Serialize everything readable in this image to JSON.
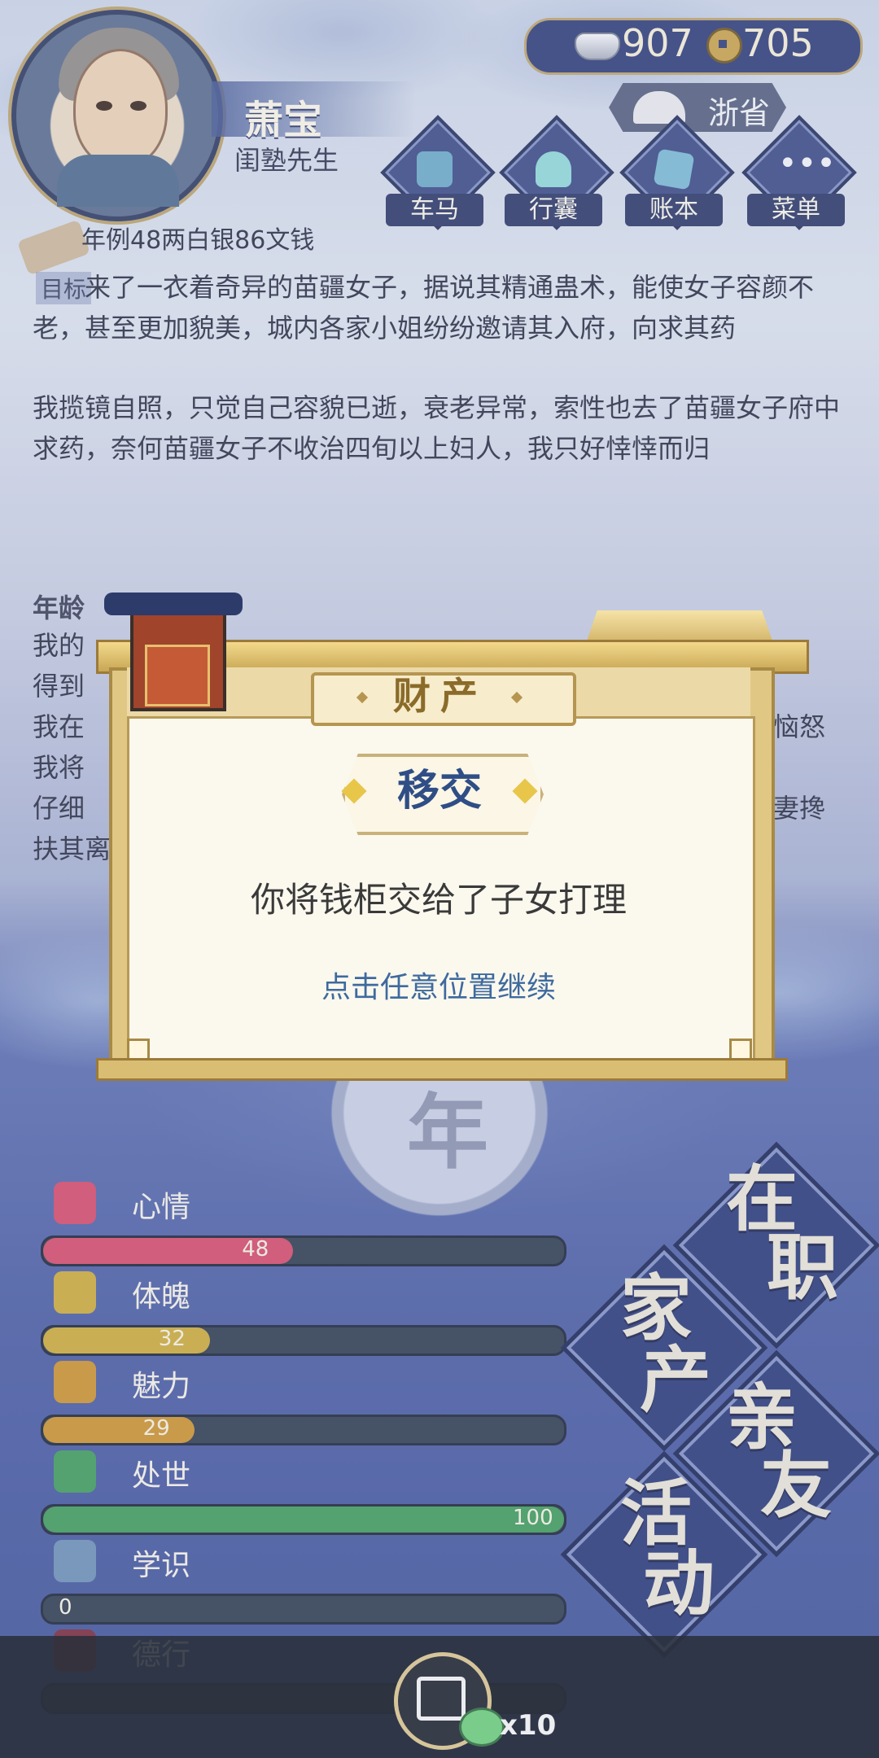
{
  "player": {
    "name": "萧宝",
    "title": "闺塾先生"
  },
  "currency": {
    "silver": "907",
    "coin": "705"
  },
  "region": {
    "label": "浙省"
  },
  "nav": [
    {
      "label": "车马",
      "icon": "carriage-icon"
    },
    {
      "label": "行囊",
      "icon": "bag-icon"
    },
    {
      "label": "账本",
      "icon": "ledger-icon"
    },
    {
      "label": "菜单",
      "icon": "menu-dots-icon"
    }
  ],
  "story": {
    "partial_line": "年例48两白银86文钱",
    "goal_label": "目标",
    "para1": "来了一衣着奇异的苗疆女子，据说其精通蛊术，能使女子容颜不老，甚至更加貌美，城内各家小姐纷纷邀请其入府，向求其药",
    "para2": "我揽镜自照，只觉自己容貌已逝，衰老异常，索性也去了苗疆女子府中求药，奈何苗疆女子不收治四旬以上妇人，我只好悻悻而归",
    "year_label": "年龄",
    "line_a": "我的",
    "line_b": "得到",
    "line_c": "我在",
    "line_c_end": "恼怒",
    "line_d": "我将",
    "line_e": "仔细",
    "line_e_end": "妻搀",
    "line_f": "扶其离"
  },
  "medallion": {
    "char": "年"
  },
  "stats": [
    {
      "label": "心情",
      "value": 48,
      "max": 100,
      "color": "#d24b6a",
      "icon": "flower-icon"
    },
    {
      "label": "体魄",
      "value": 32,
      "max": 100,
      "color": "#c9a93b",
      "icon": "vase-icon"
    },
    {
      "label": "魅力",
      "value": 29,
      "max": 100,
      "color": "#c9912f",
      "icon": "mirror-icon"
    },
    {
      "label": "处世",
      "value": 100,
      "max": 100,
      "color": "#3f9a5c",
      "icon": "sword-icon"
    },
    {
      "label": "学识",
      "value": 0,
      "max": 100,
      "color": "#6b8fb4",
      "icon": "brush-pot-icon"
    },
    {
      "label": "德行",
      "value": "",
      "max": 100,
      "color": "#7a2b3e",
      "icon": "coin-string-icon"
    }
  ],
  "actions": [
    {
      "label_top": "在",
      "label_bottom": "职"
    },
    {
      "label_top": "家",
      "label_bottom": "产"
    },
    {
      "label_top": "亲",
      "label_bottom": "友"
    },
    {
      "label_top": "活",
      "label_bottom": "动"
    }
  ],
  "bottom": {
    "token_count": "x10"
  },
  "modal": {
    "header": "财产",
    "title": "移交",
    "message": "你将钱柜交给了子女打理",
    "hint": "点击任意位置继续"
  }
}
